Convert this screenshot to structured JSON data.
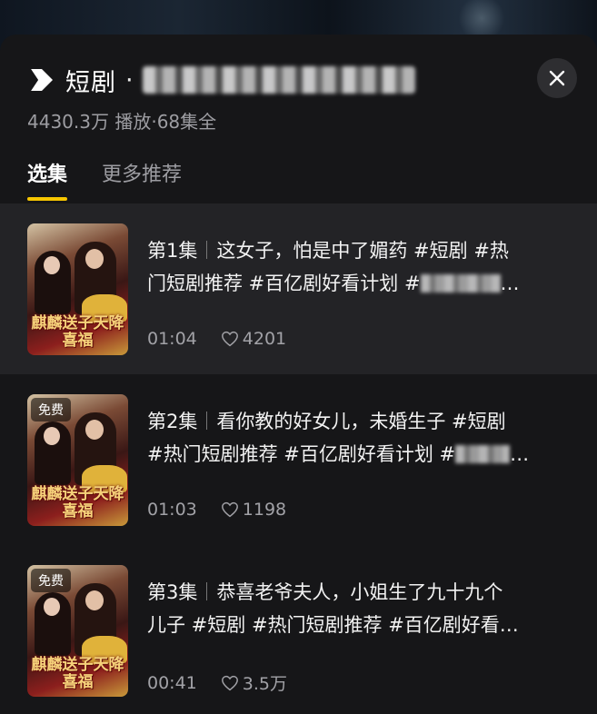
{
  "brand": {
    "name": "短剧",
    "dot": "·",
    "icon": "play-logo-icon"
  },
  "stats": "4430.3万 播放·68集全",
  "close_icon": "close-icon",
  "tabs": [
    {
      "label": "选集",
      "active": true
    },
    {
      "label": "更多推荐",
      "active": false
    }
  ],
  "accent_color": "#f7c600",
  "episodes": [
    {
      "label": "第1集",
      "desc_line1": "这女子，怕是中了媚药 #短剧 #热",
      "desc_line2": "门短剧推荐 #百亿剧好看计划 #",
      "ellipsis": "…",
      "duration": "01:04",
      "likes": "4201",
      "badge": "",
      "cover_title": "麒麟送子天降喜福"
    },
    {
      "label": "第2集",
      "desc_line1": "看你教的好女儿，未婚生子 #短剧",
      "desc_line2": "#热门短剧推荐 #百亿剧好看计划 #",
      "ellipsis": "…",
      "duration": "01:03",
      "likes": "1198",
      "badge": "免费",
      "cover_title": "麒麟送子天降喜福"
    },
    {
      "label": "第3集",
      "desc_line1": "恭喜老爷夫人，小姐生了九十九个",
      "desc_line2": "儿子 #短剧 #热门短剧推荐 #百亿剧好看…",
      "ellipsis": "",
      "duration": "00:41",
      "likes": "3.5万",
      "badge": "免费",
      "cover_title": "麒麟送子天降喜福"
    }
  ]
}
